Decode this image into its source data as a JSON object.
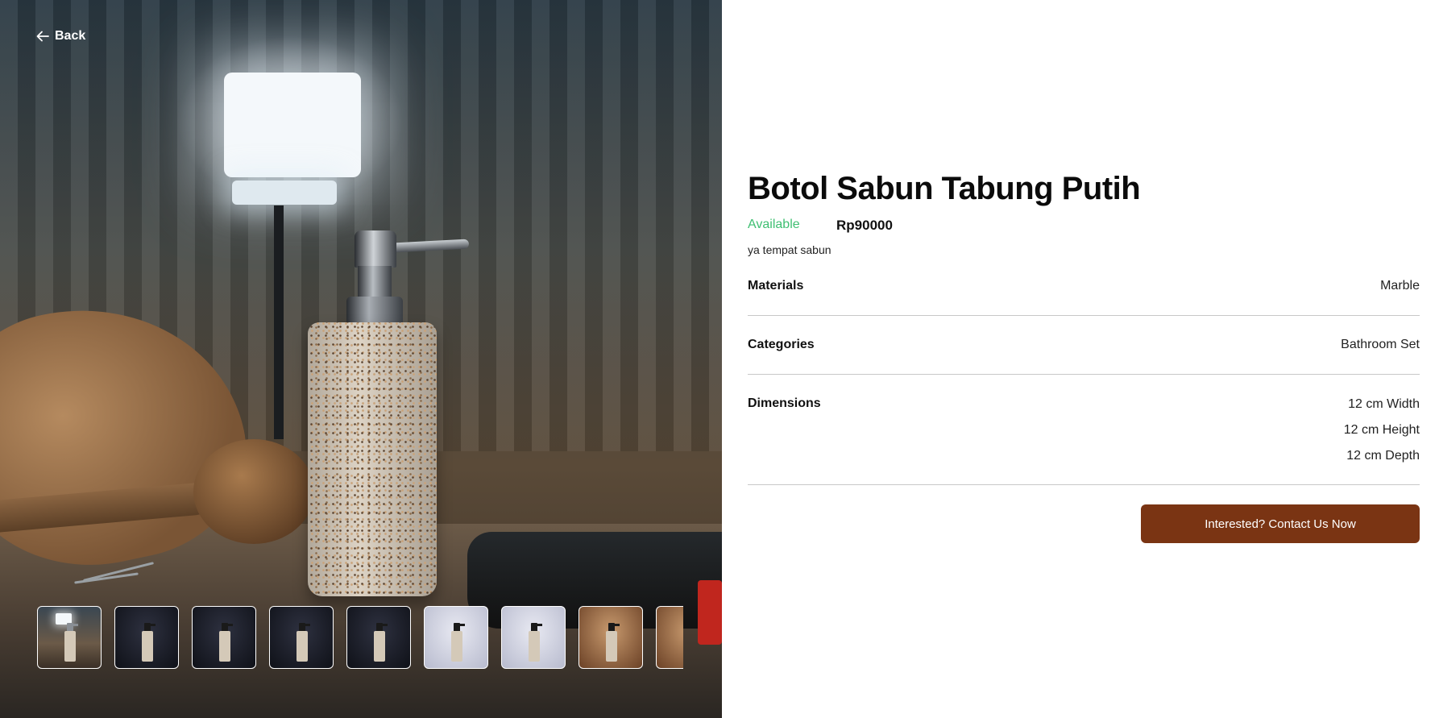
{
  "nav": {
    "back_label": "Back"
  },
  "product": {
    "title": "Botol Sabun Tabung Putih",
    "availability": "Available",
    "price": "Rp90000",
    "description": "ya tempat sabun"
  },
  "specs": {
    "materials": {
      "label": "Materials",
      "value": "Marble"
    },
    "categories": {
      "label": "Categories",
      "value": "Bathroom Set"
    },
    "dimensions": {
      "label": "Dimensions",
      "values": [
        "12 cm Width",
        "12 cm Height",
        "12 cm Depth"
      ]
    }
  },
  "cta": {
    "label": "Interested? Contact Us Now"
  },
  "gallery": {
    "thumbnail_count_visible": 9,
    "selected_index": 0
  },
  "colors": {
    "available": "#3fbf72",
    "cta_background": "#7a3413",
    "divider": "#c8c8c8"
  }
}
